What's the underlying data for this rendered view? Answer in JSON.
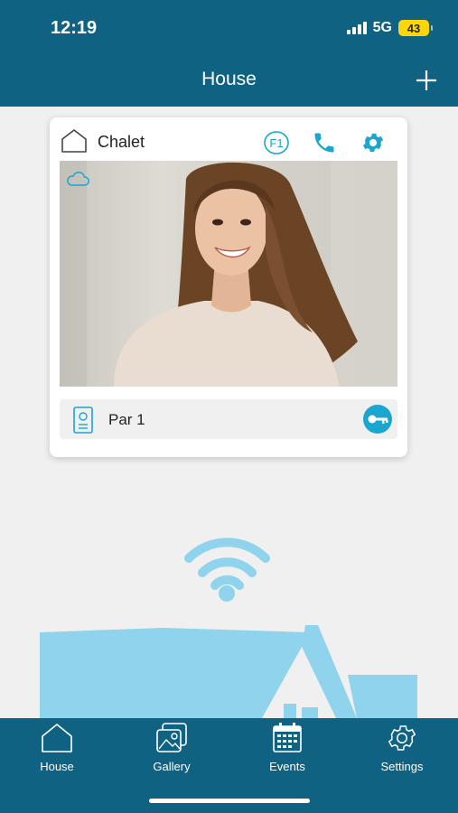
{
  "status_bar": {
    "time": "12:19",
    "network": "5G",
    "battery": "43"
  },
  "header": {
    "title": "House"
  },
  "card": {
    "site_name": "Chalet",
    "badge": "F1",
    "device": {
      "name": "Par 1"
    }
  },
  "nav": {
    "items": [
      {
        "label": "House",
        "icon": "home-icon"
      },
      {
        "label": "Gallery",
        "icon": "gallery-icon"
      },
      {
        "label": "Events",
        "icon": "calendar-icon"
      },
      {
        "label": "Settings",
        "icon": "gear-icon"
      }
    ]
  },
  "colors": {
    "primary": "#0f6282",
    "accent": "#1aa6d0",
    "illustration": "#8fd3ec",
    "background": "#f0f0f0"
  }
}
